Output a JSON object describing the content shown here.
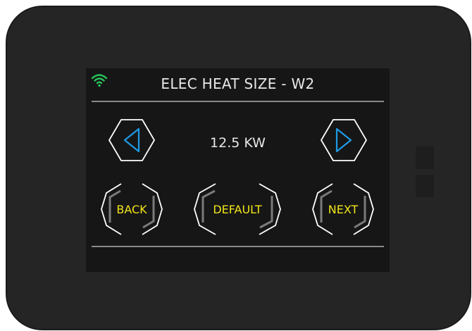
{
  "colors": {
    "bezel": "#252525",
    "screen": "#161616",
    "text": "#e8e8e8",
    "button_text": "#f2e51a",
    "arrow": "#1e9be6",
    "wifi": "#27c45a",
    "rule": "#8a8a8a"
  },
  "header": {
    "title": "ELEC HEAT SIZE - W2",
    "status_icon": "wifi-icon"
  },
  "setting": {
    "value": "12.5 KW",
    "decrease_icon": "arrow-left-icon",
    "increase_icon": "arrow-right-icon"
  },
  "buttons": {
    "back": "BACK",
    "default": "DEFAULT",
    "next": "NEXT"
  }
}
